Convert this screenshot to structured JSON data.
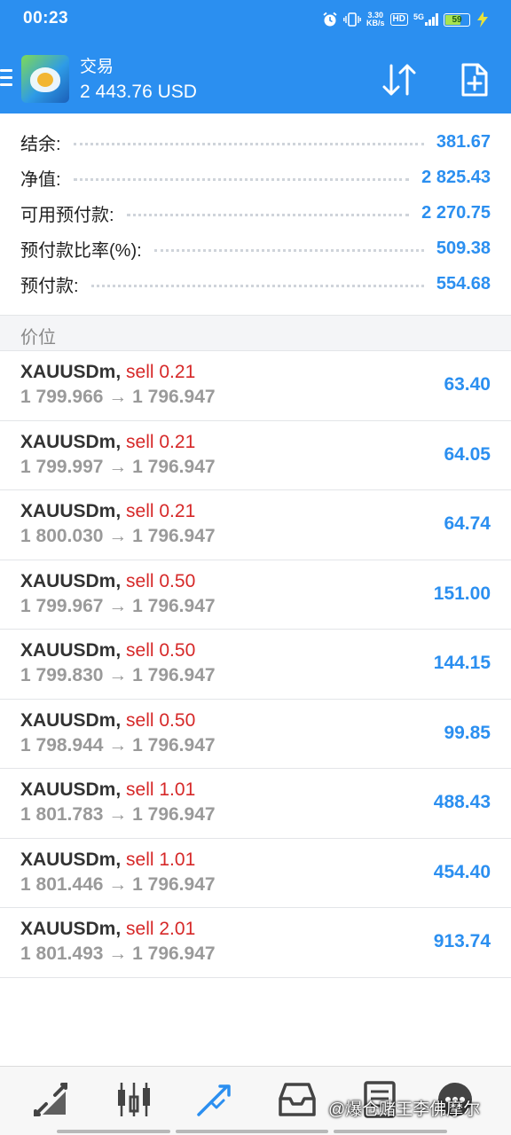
{
  "status_bar": {
    "time": "00:23",
    "net_speed_value": "3.30",
    "net_speed_unit": "KB/s",
    "hd_badge": "HD",
    "network": "5G",
    "battery": "59"
  },
  "header": {
    "title": "交易",
    "balance_line": "2 443.76 USD",
    "icons": [
      "menu-icon",
      "app-logo",
      "sort-arrows-icon",
      "new-order-icon"
    ]
  },
  "summary": [
    {
      "label": "结余:",
      "value": "381.67"
    },
    {
      "label": "净值:",
      "value": "2 825.43"
    },
    {
      "label": "可用预付款:",
      "value": "2 270.75"
    },
    {
      "label": "预付款比率(%):",
      "value": "509.38"
    },
    {
      "label": "预付款:",
      "value": "554.68"
    }
  ],
  "section_title": "价位",
  "positions": [
    {
      "symbol": "XAUUSDm,",
      "side": "sell 0.21",
      "open": "1 799.966",
      "arrow": "→",
      "current": "1 796.947",
      "profit": "63.40"
    },
    {
      "symbol": "XAUUSDm,",
      "side": "sell 0.21",
      "open": "1 799.997",
      "arrow": "→",
      "current": "1 796.947",
      "profit": "64.05"
    },
    {
      "symbol": "XAUUSDm,",
      "side": "sell 0.21",
      "open": "1 800.030",
      "arrow": "→",
      "current": "1 796.947",
      "profit": "64.74"
    },
    {
      "symbol": "XAUUSDm,",
      "side": "sell 0.50",
      "open": "1 799.967",
      "arrow": "→",
      "current": "1 796.947",
      "profit": "151.00"
    },
    {
      "symbol": "XAUUSDm,",
      "side": "sell 0.50",
      "open": "1 799.830",
      "arrow": "→",
      "current": "1 796.947",
      "profit": "144.15"
    },
    {
      "symbol": "XAUUSDm,",
      "side": "sell 0.50",
      "open": "1 798.944",
      "arrow": "→",
      "current": "1 796.947",
      "profit": "99.85"
    },
    {
      "symbol": "XAUUSDm,",
      "side": "sell 1.01",
      "open": "1 801.783",
      "arrow": "→",
      "current": "1 796.947",
      "profit": "488.43"
    },
    {
      "symbol": "XAUUSDm,",
      "side": "sell 1.01",
      "open": "1 801.446",
      "arrow": "→",
      "current": "1 796.947",
      "profit": "454.40"
    },
    {
      "symbol": "XAUUSDm,",
      "side": "sell 2.01",
      "open": "1 801.493",
      "arrow": "→",
      "current": "1 796.947",
      "profit": "913.74"
    }
  ],
  "bottom_nav": [
    {
      "name": "quotes-icon",
      "active": false
    },
    {
      "name": "chart-candles-icon",
      "active": false
    },
    {
      "name": "trade-icon",
      "active": true
    },
    {
      "name": "history-inbox-icon",
      "active": false
    },
    {
      "name": "news-icon",
      "active": false
    },
    {
      "name": "messages-icon",
      "active": false
    }
  ],
  "watermark": "@爆仓赌王李佛摩尔",
  "colors": {
    "header_blue": "#2b8ff0",
    "value_blue": "#2b8ff0",
    "sell_red": "#d62828",
    "active_nav": "#2b8ff0",
    "inactive_nav": "#444444"
  }
}
